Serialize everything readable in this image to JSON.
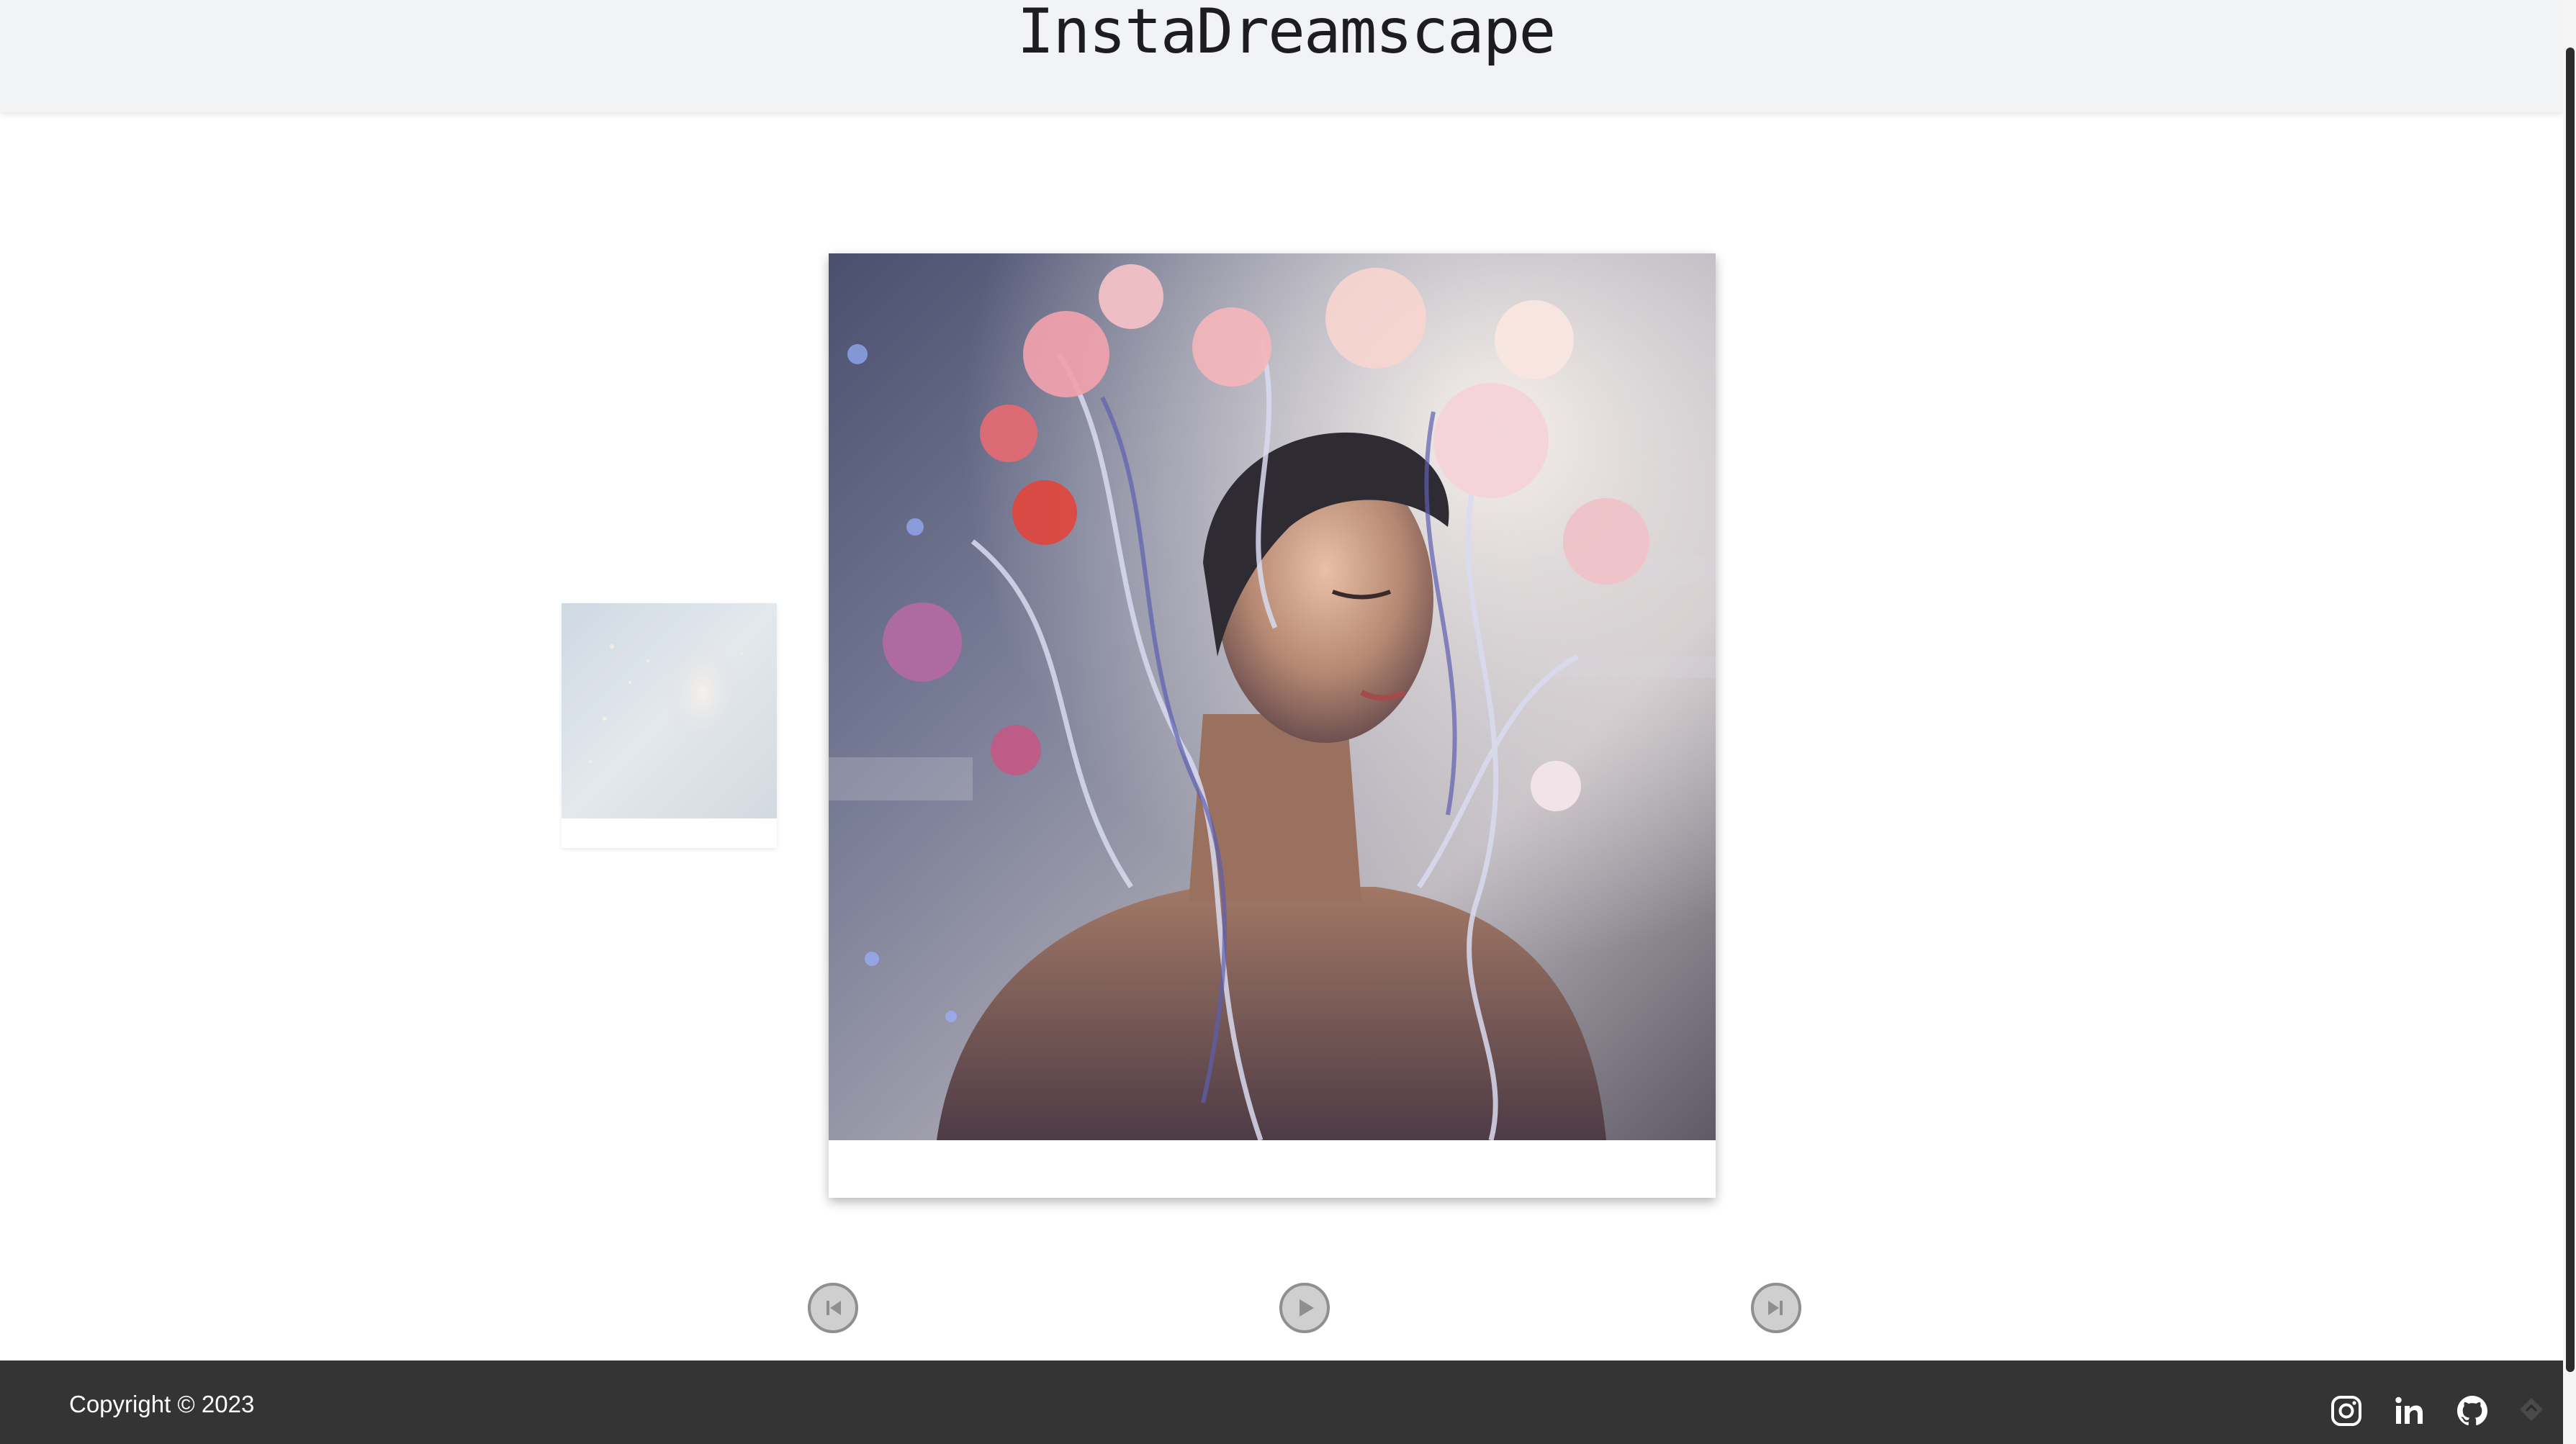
{
  "header": {
    "title": "InstaDreamscape"
  },
  "carousel": {
    "current_image": "ai-art-woman-with-flowers-and-ribbons",
    "previous_image": "ai-art-faded-woman-portrait",
    "controls": {
      "prev_icon": "skip-previous-icon",
      "play_icon": "play-icon",
      "next_icon": "skip-next-icon"
    }
  },
  "footer": {
    "copyright": "Copyright © 2023",
    "social": [
      "instagram-icon",
      "linkedin-icon",
      "github-icon"
    ]
  },
  "colors": {
    "header_bg": "#f2f3f5",
    "footer_bg": "#343434",
    "title_text": "#1d1d1f",
    "control_bg": "#cfcfcf",
    "control_border": "#8f8f8f"
  }
}
